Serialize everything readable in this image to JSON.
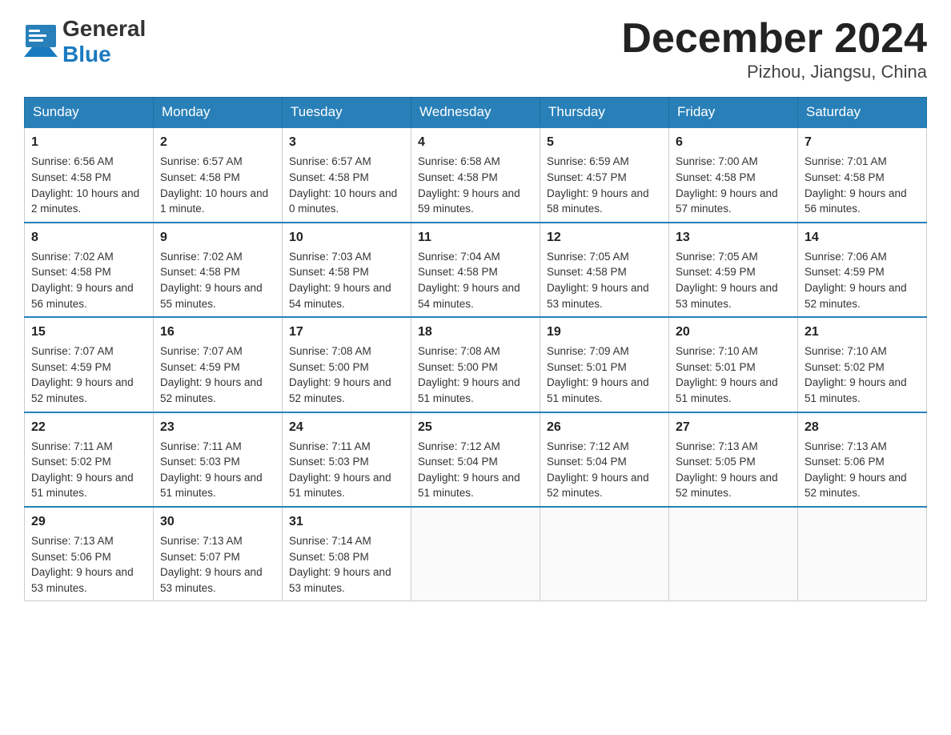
{
  "header": {
    "logo_general": "General",
    "logo_blue": "Blue",
    "month_title": "December 2024",
    "location": "Pizhou, Jiangsu, China"
  },
  "days_of_week": [
    "Sunday",
    "Monday",
    "Tuesday",
    "Wednesday",
    "Thursday",
    "Friday",
    "Saturday"
  ],
  "weeks": [
    [
      {
        "day": 1,
        "sunrise": "6:56 AM",
        "sunset": "4:58 PM",
        "daylight": "10 hours and 2 minutes."
      },
      {
        "day": 2,
        "sunrise": "6:57 AM",
        "sunset": "4:58 PM",
        "daylight": "10 hours and 1 minute."
      },
      {
        "day": 3,
        "sunrise": "6:57 AM",
        "sunset": "4:58 PM",
        "daylight": "10 hours and 0 minutes."
      },
      {
        "day": 4,
        "sunrise": "6:58 AM",
        "sunset": "4:58 PM",
        "daylight": "9 hours and 59 minutes."
      },
      {
        "day": 5,
        "sunrise": "6:59 AM",
        "sunset": "4:57 PM",
        "daylight": "9 hours and 58 minutes."
      },
      {
        "day": 6,
        "sunrise": "7:00 AM",
        "sunset": "4:58 PM",
        "daylight": "9 hours and 57 minutes."
      },
      {
        "day": 7,
        "sunrise": "7:01 AM",
        "sunset": "4:58 PM",
        "daylight": "9 hours and 56 minutes."
      }
    ],
    [
      {
        "day": 8,
        "sunrise": "7:02 AM",
        "sunset": "4:58 PM",
        "daylight": "9 hours and 56 minutes."
      },
      {
        "day": 9,
        "sunrise": "7:02 AM",
        "sunset": "4:58 PM",
        "daylight": "9 hours and 55 minutes."
      },
      {
        "day": 10,
        "sunrise": "7:03 AM",
        "sunset": "4:58 PM",
        "daylight": "9 hours and 54 minutes."
      },
      {
        "day": 11,
        "sunrise": "7:04 AM",
        "sunset": "4:58 PM",
        "daylight": "9 hours and 54 minutes."
      },
      {
        "day": 12,
        "sunrise": "7:05 AM",
        "sunset": "4:58 PM",
        "daylight": "9 hours and 53 minutes."
      },
      {
        "day": 13,
        "sunrise": "7:05 AM",
        "sunset": "4:59 PM",
        "daylight": "9 hours and 53 minutes."
      },
      {
        "day": 14,
        "sunrise": "7:06 AM",
        "sunset": "4:59 PM",
        "daylight": "9 hours and 52 minutes."
      }
    ],
    [
      {
        "day": 15,
        "sunrise": "7:07 AM",
        "sunset": "4:59 PM",
        "daylight": "9 hours and 52 minutes."
      },
      {
        "day": 16,
        "sunrise": "7:07 AM",
        "sunset": "4:59 PM",
        "daylight": "9 hours and 52 minutes."
      },
      {
        "day": 17,
        "sunrise": "7:08 AM",
        "sunset": "5:00 PM",
        "daylight": "9 hours and 52 minutes."
      },
      {
        "day": 18,
        "sunrise": "7:08 AM",
        "sunset": "5:00 PM",
        "daylight": "9 hours and 51 minutes."
      },
      {
        "day": 19,
        "sunrise": "7:09 AM",
        "sunset": "5:01 PM",
        "daylight": "9 hours and 51 minutes."
      },
      {
        "day": 20,
        "sunrise": "7:10 AM",
        "sunset": "5:01 PM",
        "daylight": "9 hours and 51 minutes."
      },
      {
        "day": 21,
        "sunrise": "7:10 AM",
        "sunset": "5:02 PM",
        "daylight": "9 hours and 51 minutes."
      }
    ],
    [
      {
        "day": 22,
        "sunrise": "7:11 AM",
        "sunset": "5:02 PM",
        "daylight": "9 hours and 51 minutes."
      },
      {
        "day": 23,
        "sunrise": "7:11 AM",
        "sunset": "5:03 PM",
        "daylight": "9 hours and 51 minutes."
      },
      {
        "day": 24,
        "sunrise": "7:11 AM",
        "sunset": "5:03 PM",
        "daylight": "9 hours and 51 minutes."
      },
      {
        "day": 25,
        "sunrise": "7:12 AM",
        "sunset": "5:04 PM",
        "daylight": "9 hours and 51 minutes."
      },
      {
        "day": 26,
        "sunrise": "7:12 AM",
        "sunset": "5:04 PM",
        "daylight": "9 hours and 52 minutes."
      },
      {
        "day": 27,
        "sunrise": "7:13 AM",
        "sunset": "5:05 PM",
        "daylight": "9 hours and 52 minutes."
      },
      {
        "day": 28,
        "sunrise": "7:13 AM",
        "sunset": "5:06 PM",
        "daylight": "9 hours and 52 minutes."
      }
    ],
    [
      {
        "day": 29,
        "sunrise": "7:13 AM",
        "sunset": "5:06 PM",
        "daylight": "9 hours and 53 minutes."
      },
      {
        "day": 30,
        "sunrise": "7:13 AM",
        "sunset": "5:07 PM",
        "daylight": "9 hours and 53 minutes."
      },
      {
        "day": 31,
        "sunrise": "7:14 AM",
        "sunset": "5:08 PM",
        "daylight": "9 hours and 53 minutes."
      },
      null,
      null,
      null,
      null
    ]
  ]
}
